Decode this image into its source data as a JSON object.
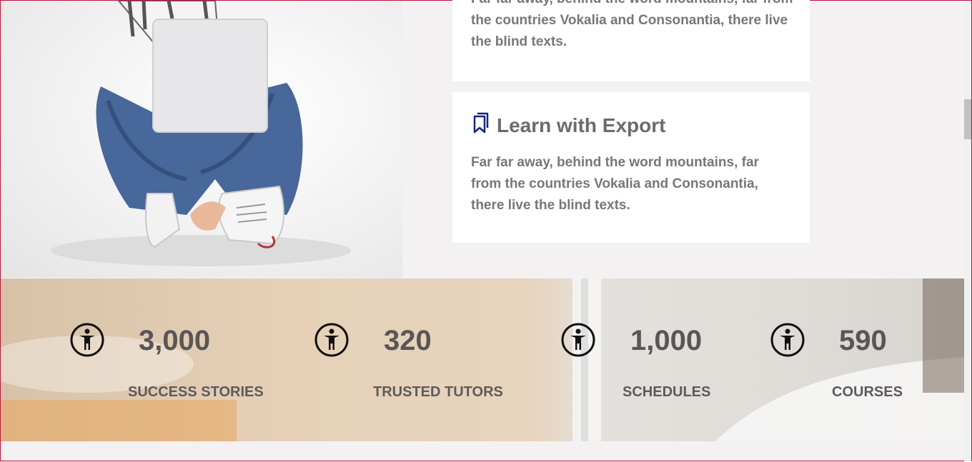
{
  "cards": [
    {
      "title": "",
      "text": "Far far away, behind the word mountains, far from the countries Vokalia and Consonantia, there live the blind texts."
    },
    {
      "title": "Learn with Export",
      "icon": "bookmarks-icon",
      "text": "Far far away, behind the word mountains, far from the countries Vokalia and Consonantia, there live the blind texts."
    }
  ],
  "stats": [
    {
      "icon": "accessibility-icon",
      "number": "3,000",
      "label": "SUCCESS STORIES"
    },
    {
      "icon": "accessibility-icon",
      "number": "320",
      "label": "TRUSTED TUTORS"
    },
    {
      "icon": "accessibility-icon",
      "number": "1,000",
      "label": "SCHEDULES"
    },
    {
      "icon": "accessibility-icon",
      "number": "590",
      "label": "COURSES"
    }
  ],
  "colors": {
    "accent_icon": "#1a237e",
    "frame_border": "#b5173a"
  }
}
